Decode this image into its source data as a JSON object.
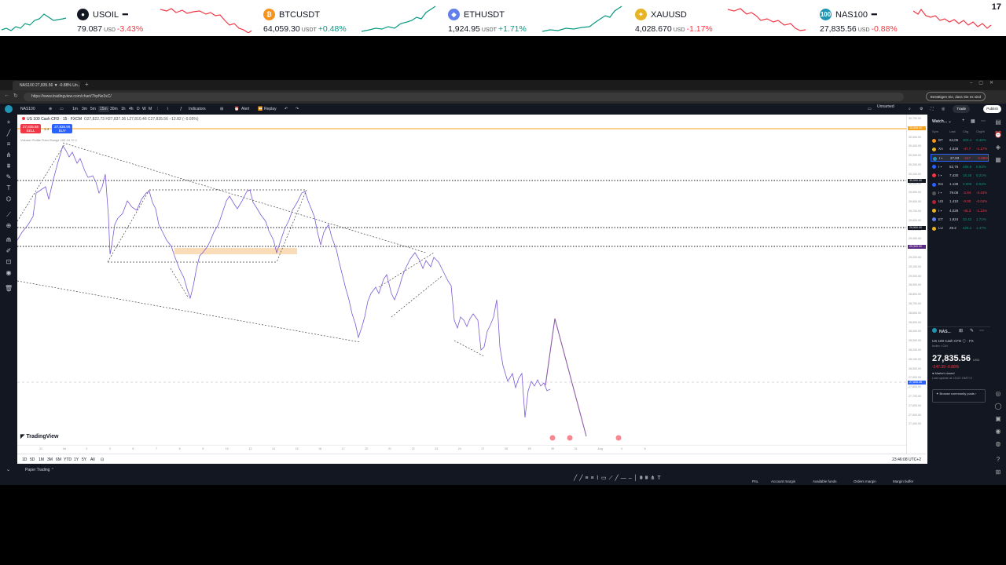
{
  "ticker": [
    {
      "symbol": "USOIL",
      "badge": "",
      "badge_color": "#131722",
      "price": "79.087",
      "unit": "USD",
      "change": "-3.43%",
      "dir": "neg"
    },
    {
      "symbol": "BTCUSDT",
      "badge": "₿",
      "badge_color": "#f7931a",
      "price": "64,059.30",
      "unit": "USDT",
      "change": "+0.48%",
      "dir": "pos"
    },
    {
      "symbol": "ETHUSDT",
      "badge": "◆",
      "badge_color": "#627eea",
      "price": "1,924.95",
      "unit": "USDT",
      "change": "+1.71%",
      "dir": "pos"
    },
    {
      "symbol": "XAUUSD",
      "badge": "✦",
      "badge_color": "#e6b422",
      "price": "4,028.670",
      "unit": "USD",
      "change": "-1.17%",
      "dir": "neg"
    },
    {
      "symbol": "NAS100",
      "badge": "100",
      "badge_color": "#2196b4",
      "price": "27,835.56",
      "unit": "USD",
      "change": "-0.88%",
      "dir": "neg"
    }
  ],
  "ticker_logo": "17",
  "browser": {
    "tab_title": "NAS100 27,835.56 ▼ -0.88% Un...",
    "url": "https://www.tradingview.com/chart/7hpNe3xC/",
    "bookmark_prompt": "Bestätigen Sie, dass Sie es sind"
  },
  "topbar": {
    "symbol": "NAS100",
    "timeframes": [
      "1m",
      "3m",
      "5m",
      "15m",
      "30m",
      "1h",
      "4h",
      "D",
      "W",
      "M"
    ],
    "active_timeframe": "15m",
    "indicators": "Indicators",
    "alert": "Alert",
    "replay": "Replay",
    "layout_name": "Unnamed",
    "trade": "Trade",
    "publish": "Publish"
  },
  "chart": {
    "title": "US 100 Cash CFD · 15 · FXCM",
    "ohlc": "O27,822.73 H27,837.36 L27,810.46 C27,835.56 −12.82 (−0.05%)",
    "sell_price": "27,835.56",
    "sell_label": "SELL",
    "spread": "1.4",
    "buy_price": "27,836.96",
    "buy_label": "BUY",
    "vp_label": "Volume Profile Fixed Range 100 24 70 2",
    "watermark": "TradingView",
    "price_labels": [
      "30,700.00",
      "30,600.00",
      "30,500.00",
      "30,400.00",
      "30,300.00",
      "30,200.00",
      "30,100.00",
      "30,000.00",
      "29,900.00",
      "29,800.00",
      "29,700.00",
      "29,600.00",
      "29,500.00",
      "29,400.00",
      "29,300.00",
      "29,200.00",
      "29,100.00",
      "29,000.00",
      "28,900.00",
      "28,800.00",
      "28,700.00",
      "28,600.00",
      "28,500.00",
      "28,400.00",
      "28,300.00",
      "28,200.00",
      "28,100.00",
      "28,000.00",
      "27,900.00",
      "27,800.00",
      "27,700.00",
      "27,600.00",
      "27,500.00",
      "27,400.00"
    ],
    "price_tags": [
      {
        "label": "30,558.91",
        "color": "#f7a21b"
      },
      {
        "label": "30,000.00",
        "color": "#131722"
      },
      {
        "label": "29,500.00",
        "color": "#131722"
      },
      {
        "label": "29,300.00",
        "color": "#5b2a86"
      },
      {
        "label": "27,835.56",
        "color": "#2962ff"
      }
    ],
    "time_labels": [
      "31",
      "Jul",
      "2",
      "3",
      "6",
      "7",
      "8",
      "9",
      "10",
      "13",
      "14",
      "15",
      "16",
      "17",
      "20",
      "21",
      "22",
      "23",
      "24",
      "27",
      "28",
      "29",
      "30",
      "31",
      "Aug",
      "4",
      "5"
    ],
    "range_buttons": [
      "1D",
      "5D",
      "1M",
      "3M",
      "6M",
      "YTD",
      "1Y",
      "5Y",
      "All"
    ],
    "clock": "23:46:08 UTC+2"
  },
  "bottom": {
    "tab": "Paper Trading",
    "account_items": [
      "PnL",
      "Account margin",
      "Available funds",
      "Orders margin",
      "Margin buffer"
    ]
  },
  "watchlist": {
    "title": "Watch...",
    "headers": [
      "Sym",
      "Last",
      "Chg",
      "Chg%"
    ],
    "rows": [
      {
        "sym": "BT",
        "last": "64,05",
        "chg": "303.4",
        "pct": "0.48%",
        "color": "#f7931a",
        "dir": "pos"
      },
      {
        "sym": "XA",
        "last": "4,028",
        "chg": "-47.7",
        "pct": "-1.17%",
        "color": "#e6b422",
        "dir": "neg"
      },
      {
        "sym": "I ▪",
        "last": "27,83",
        "chg": "-247",
        "pct": "-0.88%",
        "color": "#2196b4",
        "dir": "neg",
        "selected": true
      },
      {
        "sym": "I ▪",
        "last": "52,76",
        "chg": "485.6",
        "pct": "0.93%",
        "color": "#2962ff",
        "dir": "pos"
      },
      {
        "sym": "I ▪",
        "last": "7,430",
        "chg": "15.28",
        "pct": "0.21%",
        "color": "#f23645",
        "dir": "pos"
      },
      {
        "sym": "EU",
        "last": "1.138",
        "chg": "0.000",
        "pct": "0.03%",
        "color": "#2962ff",
        "dir": "pos"
      },
      {
        "sym": "I ▪",
        "last": "79.08",
        "chg": "-2.84",
        "pct": "-3.43%",
        "color": "#555555",
        "dir": "neg"
      },
      {
        "sym": "US",
        "last": "1.410",
        "chg": "-0.00",
        "pct": "-0.04%",
        "color": "#b22234",
        "dir": "neg"
      },
      {
        "sym": "I ▪",
        "last": "4,028",
        "chg": "-46.3",
        "pct": "-1.13%",
        "color": "#e6b422",
        "dir": "neg"
      },
      {
        "sym": "ET",
        "last": "1,924",
        "chg": "32.42",
        "pct": "1.71%",
        "color": "#627eea",
        "dir": "pos"
      },
      {
        "sym": "LU",
        "last": "29.2",
        "chg": "425.2",
        "pct": "1.47%",
        "color": "#e6b422",
        "dir": "pos"
      }
    ]
  },
  "details": {
    "name": "NAS...",
    "desc": "US 100 Cash CFD ⓘ · FX",
    "sub": "Index • Cfd",
    "price": "27,835.56",
    "unit": "USD",
    "change": "-247.39 -0.88%",
    "status": "● Market closed",
    "updated": "Last update at 23:22 GMT+2",
    "ideas": "Browse community posts ›"
  }
}
